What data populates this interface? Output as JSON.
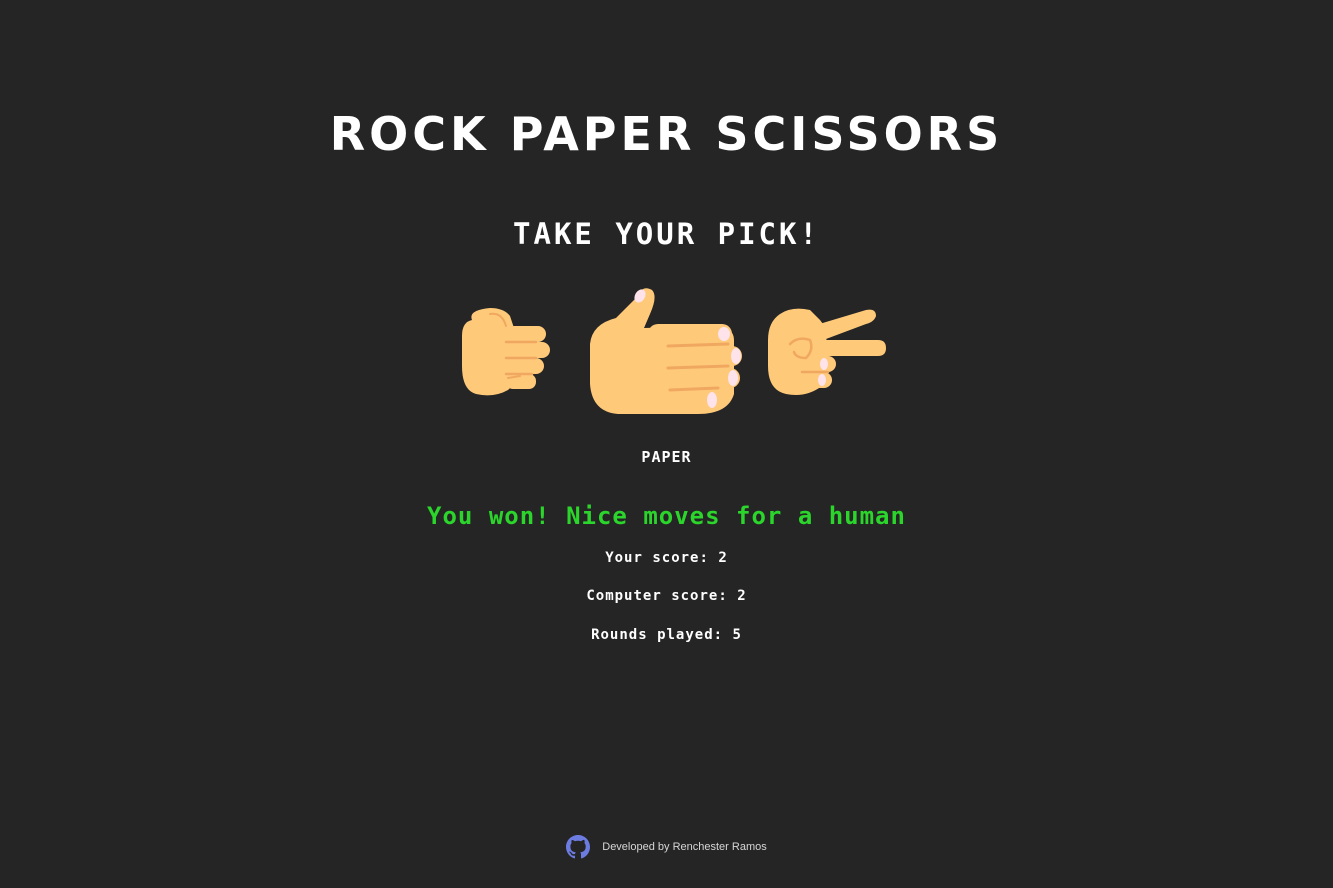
{
  "header": {
    "title": "ROCK PAPER SCISSORS",
    "subtitle": "TAKE YOUR PICK!"
  },
  "choices": [
    {
      "name": "rock",
      "icon": "fist-hand-icon"
    },
    {
      "name": "paper",
      "icon": "flat-hand-icon"
    },
    {
      "name": "scissors",
      "icon": "scissors-hand-icon"
    }
  ],
  "game": {
    "selected_choice": "PAPER",
    "result_message": "You won! Nice moves for a human",
    "result_color": "#2bd52b",
    "your_score": "Your score: 2",
    "computer_score": "Computer score: 2",
    "rounds_played": "Rounds played: 5"
  },
  "footer": {
    "icon": "github-icon",
    "icon_color": "#6c7ce0",
    "credit": "Developed by Renchester Ramos"
  },
  "colors": {
    "background": "#252525",
    "text": "#ffffff",
    "skin": "#ffc97a",
    "skin_shade": "#f0a860",
    "nail": "#ffe3ea"
  }
}
